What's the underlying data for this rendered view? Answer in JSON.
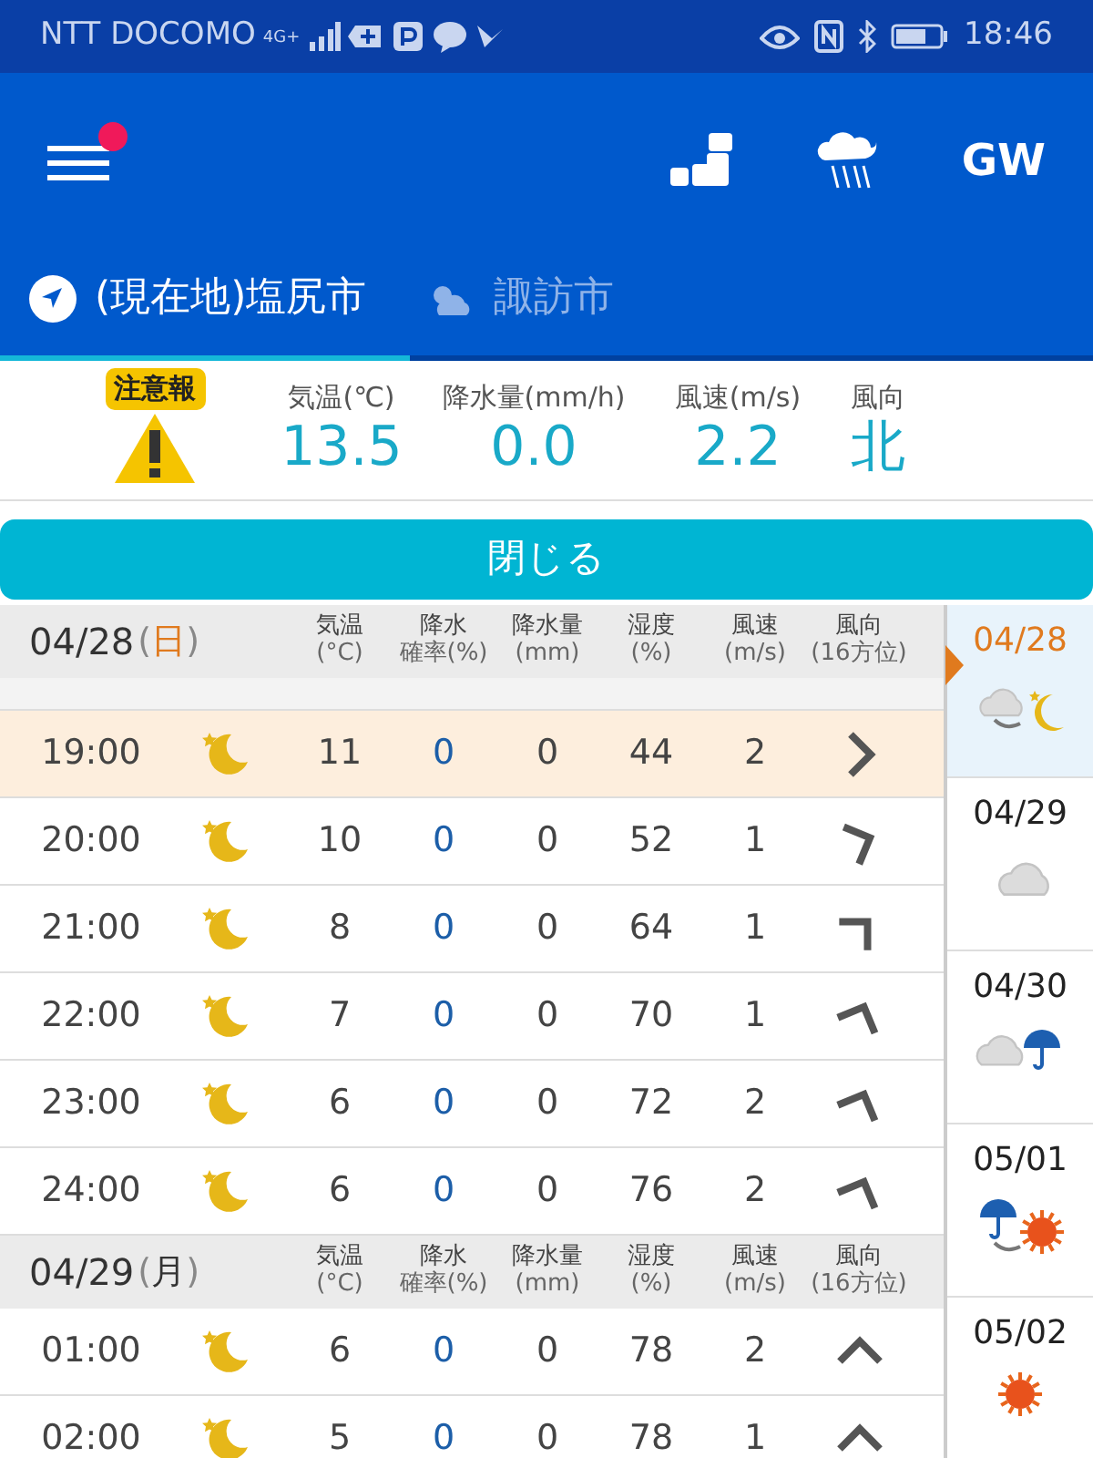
{
  "status_bar": {
    "carrier": "NTT DOCOMO",
    "network": "4G+",
    "time": "18:46"
  },
  "header": {
    "menu_badge": true,
    "gw_label": "GW"
  },
  "tabs": [
    {
      "label": "(現在地)塩尻市",
      "kind": "location",
      "selected": true
    },
    {
      "label": "諏訪市",
      "kind": "weather",
      "selected": false
    }
  ],
  "current": {
    "alert_label": "注意報",
    "readings": [
      {
        "label": "気温(℃)",
        "value": "13.5"
      },
      {
        "label": "降水量(mm/h)",
        "value": "0.0"
      },
      {
        "label": "風速(m/s)",
        "value": "2.2"
      },
      {
        "label": "風向",
        "value": "北"
      }
    ]
  },
  "close_button": "閉じる",
  "days": [
    {
      "date": "04/28",
      "weekday": "(日)",
      "holiday": true,
      "hidden_row": true,
      "column_headers": [
        [
          "気温",
          "(°C)"
        ],
        [
          "降水",
          "確率(%)"
        ],
        [
          "降水量",
          "(mm)"
        ],
        [
          "湿度",
          "(%)"
        ],
        [
          "風速",
          "(m/s)"
        ],
        [
          "風向",
          "(16方位)"
        ]
      ],
      "rows": [
        {
          "time": "19:00",
          "kind": "moon",
          "temp": "11",
          "pop": "0",
          "amount": "0",
          "humidity": "44",
          "wind": "2",
          "arrow": {
            "kind": "e"
          },
          "selected": true
        },
        {
          "time": "20:00",
          "kind": "moon",
          "temp": "10",
          "pop": "0",
          "amount": "0",
          "humidity": "52",
          "wind": "1",
          "arrow": {
            "kind": "ene"
          },
          "selected": false
        },
        {
          "time": "21:00",
          "kind": "moon",
          "temp": "8",
          "pop": "0",
          "amount": "0",
          "humidity": "64",
          "wind": "1",
          "arrow": {
            "kind": "ne"
          },
          "selected": false
        },
        {
          "time": "22:00",
          "kind": "moon",
          "temp": "7",
          "pop": "0",
          "amount": "0",
          "humidity": "70",
          "wind": "1",
          "arrow": {
            "kind": "nne"
          },
          "selected": false
        },
        {
          "time": "23:00",
          "kind": "moon",
          "temp": "6",
          "pop": "0",
          "amount": "0",
          "humidity": "72",
          "wind": "2",
          "arrow": {
            "kind": "nne"
          },
          "selected": false
        },
        {
          "time": "24:00",
          "kind": "moon",
          "temp": "6",
          "pop": "0",
          "amount": "0",
          "humidity": "76",
          "wind": "2",
          "arrow": {
            "kind": "nne"
          },
          "selected": false
        }
      ]
    },
    {
      "date": "04/29",
      "weekday": "(月)",
      "holiday": false,
      "hidden_row": false,
      "column_headers": [
        [
          "気温",
          "(°C)"
        ],
        [
          "降水",
          "確率(%)"
        ],
        [
          "降水量",
          "(mm)"
        ],
        [
          "湿度",
          "(%)"
        ],
        [
          "風速",
          "(m/s)"
        ],
        [
          "風向",
          "(16方位)"
        ]
      ],
      "rows": [
        {
          "time": "01:00",
          "kind": "moon",
          "temp": "6",
          "pop": "0",
          "amount": "0",
          "humidity": "78",
          "wind": "2",
          "arrow": {
            "kind": "n"
          },
          "selected": false
        },
        {
          "time": "02:00",
          "kind": "moon",
          "temp": "5",
          "pop": "0",
          "amount": "0",
          "humidity": "78",
          "wind": "1",
          "arrow": {
            "kind": "n"
          },
          "selected": false
        }
      ]
    }
  ],
  "date_list": [
    {
      "date": "04/28",
      "kind": "cloudy-to-moon",
      "selected": true
    },
    {
      "date": "04/29",
      "kind": "cloudy",
      "selected": false
    },
    {
      "date": "04/30",
      "kind": "cloudy-rain",
      "selected": false
    },
    {
      "date": "05/01",
      "kind": "rain-to-sunny",
      "selected": false
    },
    {
      "date": "05/02",
      "kind": "sunny",
      "selected": false
    }
  ]
}
